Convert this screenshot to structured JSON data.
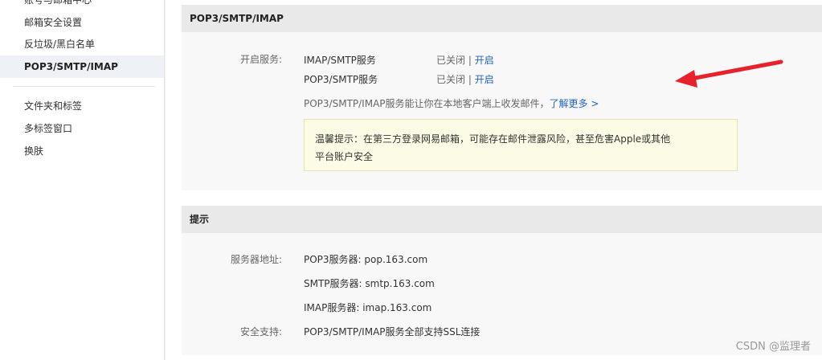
{
  "sidebar": {
    "items": [
      {
        "label": "账号与邮箱中心"
      },
      {
        "label": "邮箱安全设置"
      },
      {
        "label": "反垃圾/黑白名单"
      },
      {
        "label": "POP3/SMTP/IMAP"
      },
      {
        "label": "文件夹和标签"
      },
      {
        "label": "多标签窗口"
      },
      {
        "label": "换肤"
      }
    ]
  },
  "service_panel": {
    "title": "POP3/SMTP/IMAP",
    "label": "开启服务:",
    "services": [
      {
        "name": "IMAP/SMTP服务",
        "status": "已关闭",
        "sep": " | ",
        "action": "开启"
      },
      {
        "name": "POP3/SMTP服务",
        "status": "已关闭",
        "sep": " | ",
        "action": "开启"
      }
    ],
    "description": "POP3/SMTP/IMAP服务能让你在本地客户端上收发邮件，",
    "learn_more": "了解更多 >",
    "tip_line1": "温馨提示：在第三方登录网易邮箱，可能存在邮件泄露风险，甚至危害Apple或其他",
    "tip_line2": "平台账户安全"
  },
  "hint_panel": {
    "title": "提示",
    "server_label": "服务器地址:",
    "servers": [
      "POP3服务器: pop.163.com",
      "SMTP服务器: smtp.163.com",
      "IMAP服务器: imap.163.com"
    ],
    "security_label": "安全支持:",
    "security_text": "POP3/SMTP/IMAP服务全部支持SSL连接"
  },
  "watermark": "CSDN @监理者",
  "colors": {
    "accent": "#2463c6",
    "arrow": "#e8222b",
    "tip_bg": "#fcfce6"
  }
}
